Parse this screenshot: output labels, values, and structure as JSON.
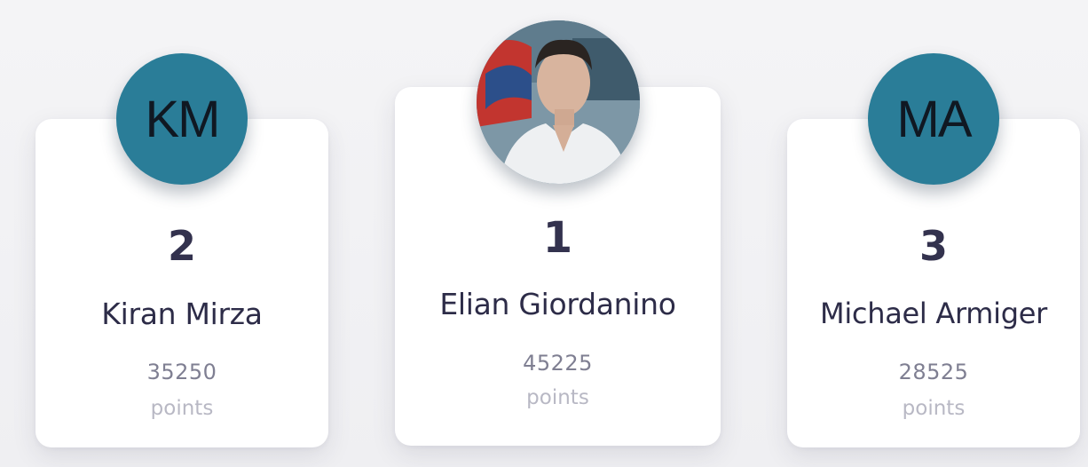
{
  "leaderboard": {
    "entries": [
      {
        "rank": "2",
        "initials": "KM",
        "name": "Kiran Mirza",
        "points": "35250",
        "points_label": "points",
        "avatar_type": "initials",
        "avatar_color": "#2a7d98"
      },
      {
        "rank": "1",
        "name": "Elian Giordanino",
        "points": "45225",
        "points_label": "points",
        "avatar_type": "photo"
      },
      {
        "rank": "3",
        "initials": "MA",
        "name": "Michael Armiger",
        "points": "28525",
        "points_label": "points",
        "avatar_type": "initials",
        "avatar_color": "#2a7d98"
      }
    ]
  }
}
